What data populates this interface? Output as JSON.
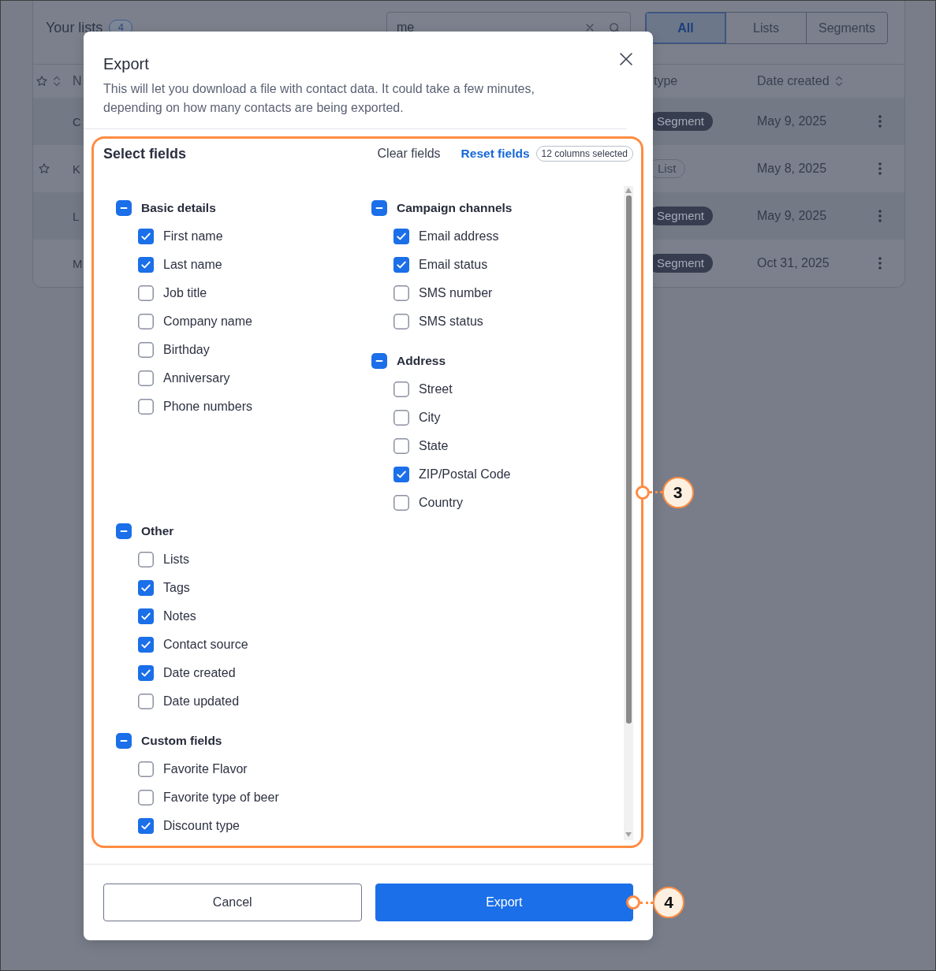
{
  "lists_page": {
    "title": "Your lists",
    "count": "4",
    "search": {
      "value": "me"
    },
    "filter_tabs": [
      {
        "label": "All",
        "selected": true
      },
      {
        "label": "Lists",
        "selected": false
      },
      {
        "label": "Segments",
        "selected": false
      }
    ],
    "columns": [
      {
        "label": "N",
        "sortable": false
      },
      {
        "label": "type",
        "sortable": false
      },
      {
        "label": "Date created",
        "sortable": true
      }
    ],
    "rows": [
      {
        "starred": false,
        "name": "C",
        "type": {
          "label": "Segment",
          "kind": "segment"
        },
        "date": "May 9, 2025"
      },
      {
        "starred": true,
        "name": "K",
        "type": {
          "label": "List",
          "kind": "list"
        },
        "date": "May 8, 2025"
      },
      {
        "starred": false,
        "name": "L",
        "type": {
          "label": "Segment",
          "kind": "segment"
        },
        "date": "May 9, 2025"
      },
      {
        "starred": false,
        "name": "M",
        "type": {
          "label": "Segment",
          "kind": "segment"
        },
        "date": "Oct 31, 2025"
      }
    ]
  },
  "export_dialog": {
    "title": "Export",
    "description": "This will let you download a file with contact data. It could take a few minutes, depending on how many contacts are being exported.",
    "fields": {
      "title": "Select fields",
      "clear_label": "Clear fields",
      "reset_label": "Reset fields",
      "count": "12 columns selected",
      "groups": [
        {
          "label": "Basic details",
          "indeterminate": true,
          "items": [
            {
              "label": "First name",
              "checked": true
            },
            {
              "label": "Last name",
              "checked": true
            },
            {
              "label": "Job title",
              "checked": false
            },
            {
              "label": "Company name",
              "checked": false
            },
            {
              "label": "Birthday",
              "checked": false
            },
            {
              "label": "Anniversary",
              "checked": false
            },
            {
              "label": "Phone numbers",
              "checked": false
            }
          ]
        },
        {
          "label": "Campaign channels",
          "indeterminate": true,
          "items": [
            {
              "label": "Email address",
              "checked": true
            },
            {
              "label": "Email status",
              "checked": true
            },
            {
              "label": "SMS number",
              "checked": false
            },
            {
              "label": "SMS status",
              "checked": false
            }
          ]
        },
        {
          "label": "Address",
          "indeterminate": true,
          "items": [
            {
              "label": "Street",
              "checked": false
            },
            {
              "label": "City",
              "checked": false
            },
            {
              "label": "State",
              "checked": false
            },
            {
              "label": "ZIP/Postal Code",
              "checked": true
            },
            {
              "label": "Country",
              "checked": false
            }
          ]
        },
        {
          "label": "Other",
          "indeterminate": true,
          "items": [
            {
              "label": "Lists",
              "checked": false
            },
            {
              "label": "Tags",
              "checked": true
            },
            {
              "label": "Notes",
              "checked": true
            },
            {
              "label": "Contact source",
              "checked": true
            },
            {
              "label": "Date created",
              "checked": true
            },
            {
              "label": "Date updated",
              "checked": false
            }
          ]
        },
        {
          "label": "Custom fields",
          "indeterminate": true,
          "items": [
            {
              "label": "Favorite Flavor",
              "checked": false
            },
            {
              "label": "Favorite type of beer",
              "checked": false
            },
            {
              "label": "Discount type",
              "checked": true
            }
          ]
        }
      ]
    },
    "buttons": [
      {
        "label": "Cancel",
        "kind": "secondary"
      },
      {
        "label": "Export",
        "kind": "primary"
      }
    ]
  },
  "annotations": [
    {
      "label": "3"
    },
    {
      "label": "4"
    }
  ]
}
